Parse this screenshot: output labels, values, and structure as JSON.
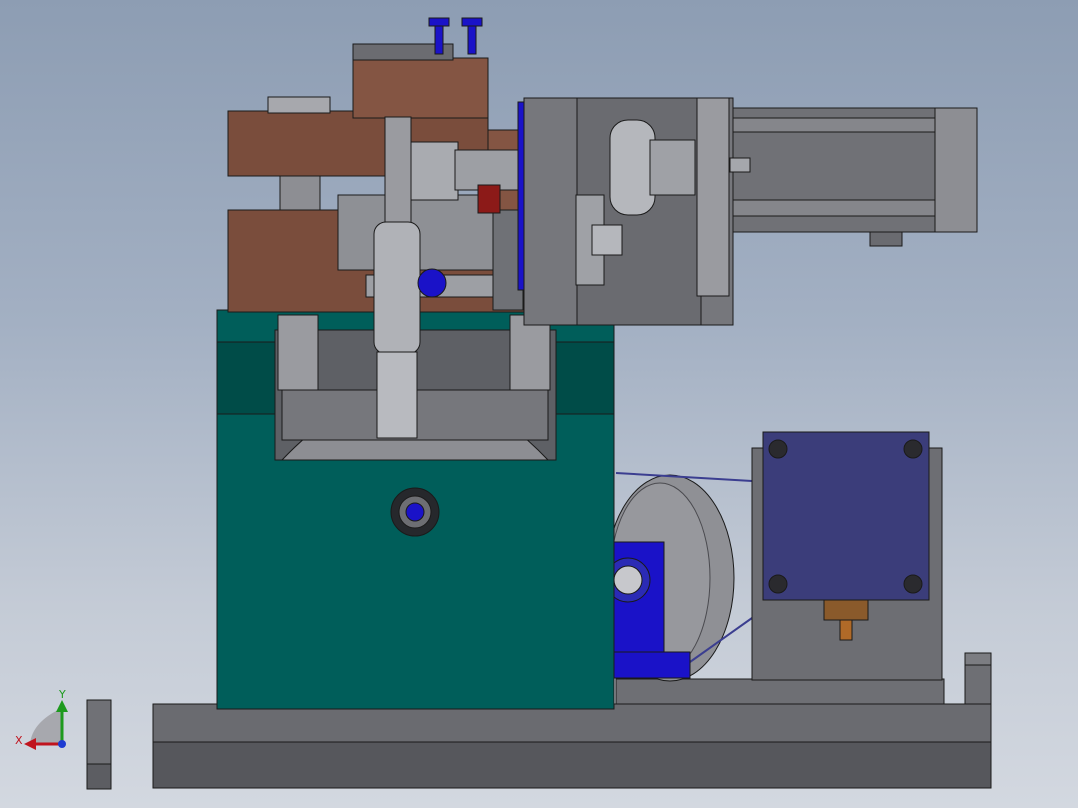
{
  "triad": {
    "x_label": "X",
    "y_label": "Y",
    "x_color": "#c0141e",
    "y_color": "#1e9a1e",
    "z_color": "#1e3cd2"
  },
  "colors": {
    "teal_housing": "#005e5a",
    "brown_blocks": "#7a4d3c",
    "steel_gray": "#6f7176",
    "light_steel": "#a7a9ad",
    "blue_parts": "#1410d2",
    "stepper_motor": "#3b3d7a",
    "base_plate": "#5f6064"
  }
}
